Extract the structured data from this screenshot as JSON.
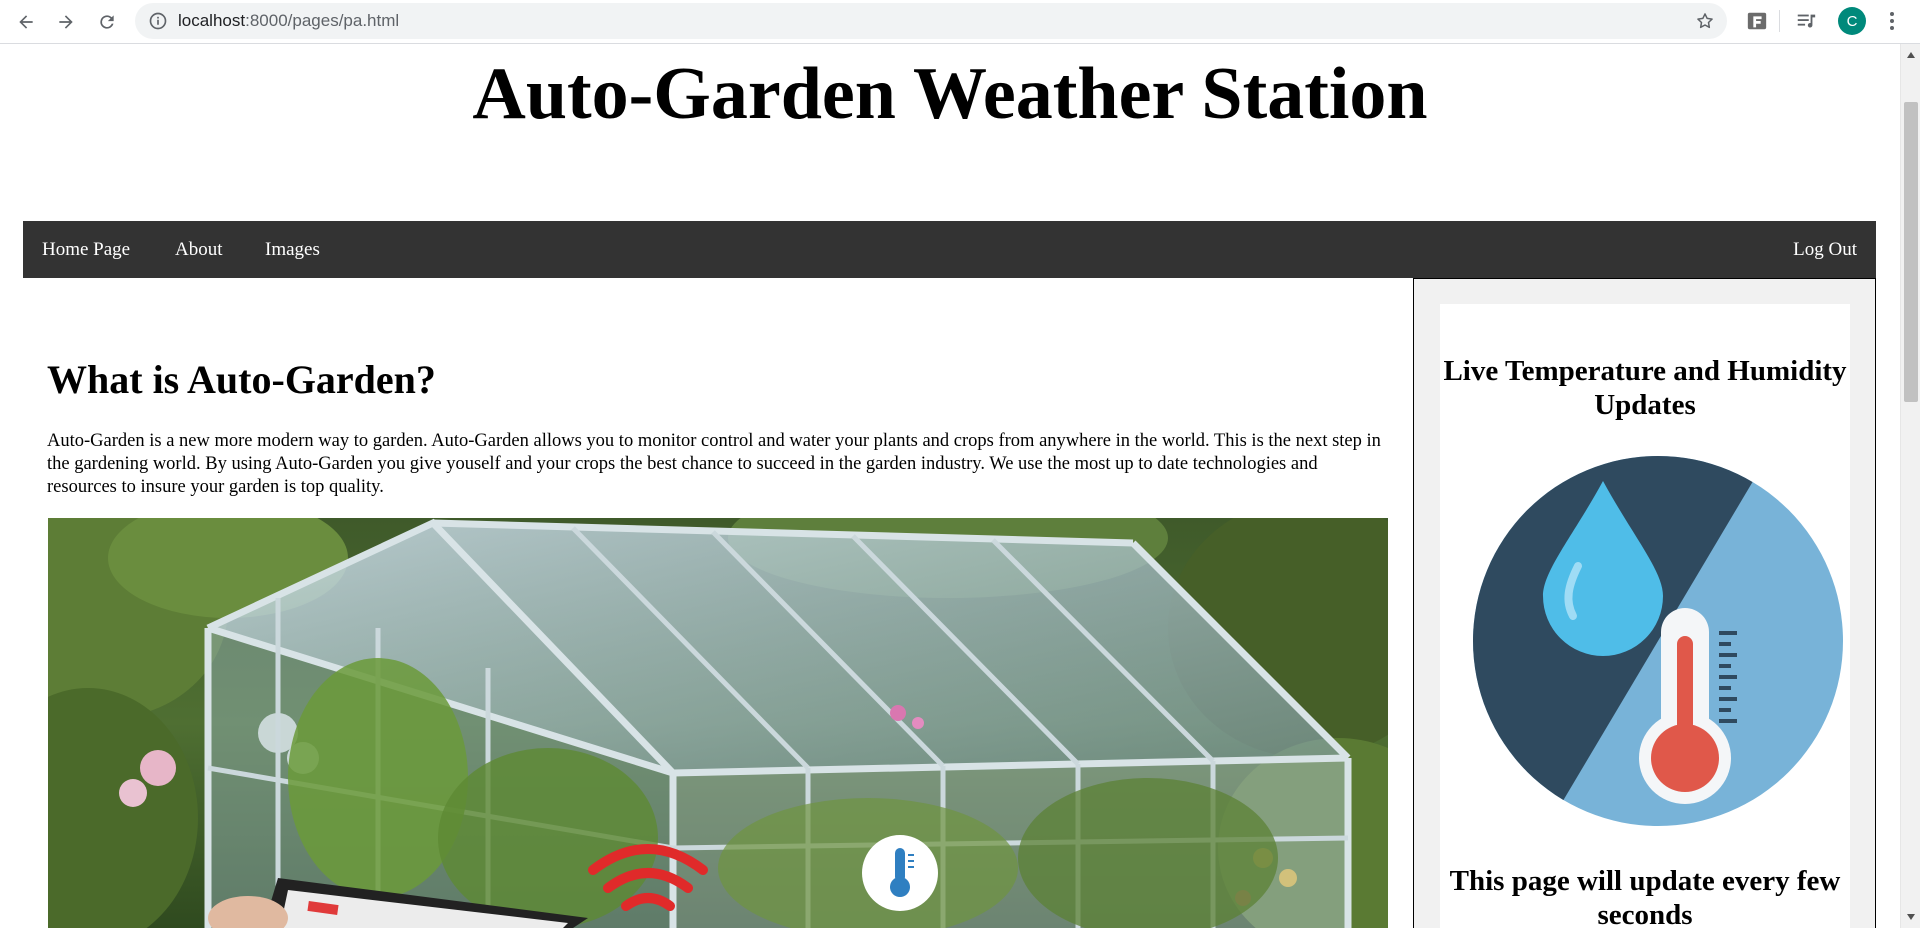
{
  "browser": {
    "url_host": "localhost",
    "url_path": ":8000/pages/pa.html",
    "profile_initial": "C"
  },
  "page": {
    "site_title": "Auto-Garden Weather Station",
    "nav": {
      "items": [
        {
          "label": "Home Page"
        },
        {
          "label": "About"
        },
        {
          "label": "Images"
        }
      ],
      "logout_label": "Log Out"
    },
    "main": {
      "heading": "What is Auto-Garden?",
      "body": "Auto-Garden is a new more modern way to garden. Auto-Garden allows you to monitor control and water your plants and crops from anywhere in the world. This is the next step in the gardening world. By using Auto-Garden you give youself and your crops the best chance to succeed in the garden industry. We use the most up to date technologies and resources to insure your garden is top quality."
    },
    "sidebar": {
      "title": "Live Temperature and Humidity Updates",
      "note": "This page will update every few seconds"
    }
  },
  "colors": {
    "navbar_bg": "#333333",
    "badge_dark": "#2f4a5f",
    "badge_light": "#78b3d8",
    "drop_blue": "#4fbde8",
    "thermo_red": "#e0584a",
    "profile_bg": "#00897b"
  },
  "icons": [
    "back-arrow-icon",
    "forward-arrow-icon",
    "reload-icon",
    "info-icon",
    "star-icon",
    "extension-icon",
    "media-icon",
    "kebab-menu-icon",
    "thermometer-icon",
    "wifi-signal-icon",
    "water-drop-icon"
  ]
}
